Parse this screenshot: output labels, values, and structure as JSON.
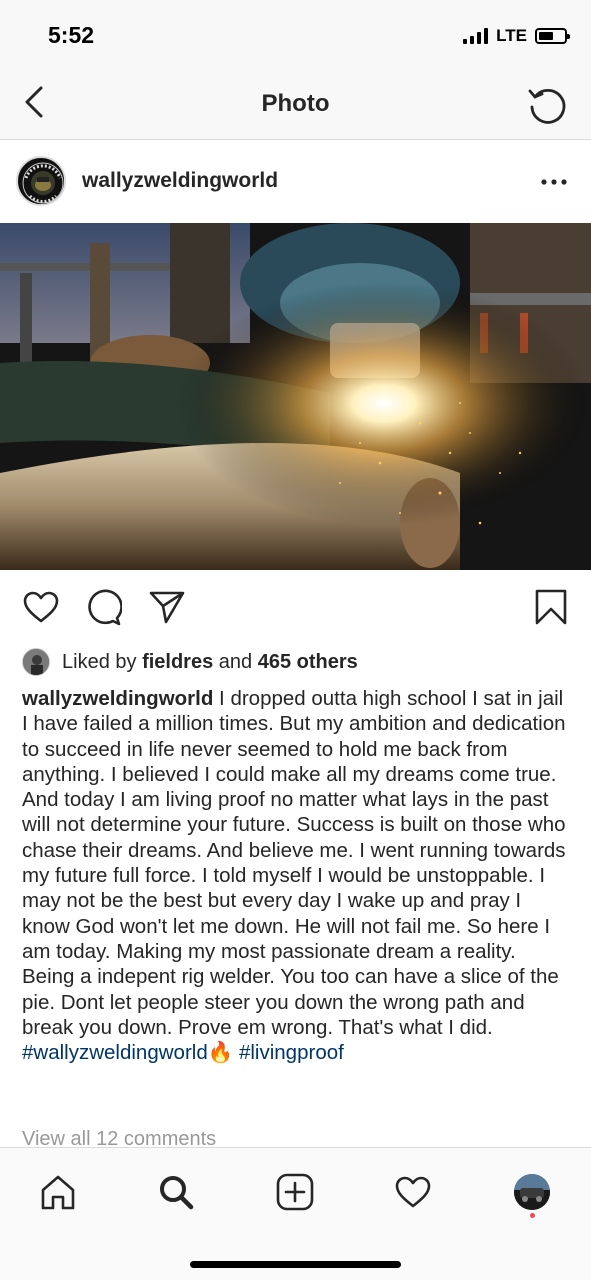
{
  "status_bar": {
    "time": "5:52",
    "network": "LTE"
  },
  "nav": {
    "title": "Photo",
    "back_icon": "chevron-left-icon",
    "refresh_icon": "refresh-icon"
  },
  "post": {
    "username": "wallyzweldingworld",
    "avatar_logo_text": "WALLYZ WELDING WORLD",
    "more_icon": "ellipsis-icon",
    "liked_by_prefix": "Liked by ",
    "liked_by_user": "fieldres",
    "liked_by_mid": " and ",
    "liked_by_others": "465 others",
    "caption_user": "wallyzweldingworld",
    "caption_text": " I dropped outta high school I sat in jail I have failed a million times. But my ambition and dedication to succeed in life never seemed to hold me back from anything. I believed I could make all my dreams come true. And today I am living proof no matter what lays in the past will not determine your future. Success is built on those who chase their dreams. And believe me. I went running towards my future full force. I told myself I would be unstoppable. I may not be the best but every day I wake up and pray I know God won't let me down. He will not fail me. So here I am today. Making my most passionate dream a reality. Being a indepent rig welder. You too can have a slice of the pie. Dont let people steer you down the wrong path and break you down. Prove em wrong. That's what I did.",
    "hashtag_1": "#wallyzweldingworld",
    "emoji": "🔥",
    "hashtag_2": "#livingproof",
    "view_comments": "View all 12 comments"
  },
  "colors": {
    "hashtag": "#003569",
    "notification_dot": "#ed4956",
    "muted": "#999999"
  }
}
